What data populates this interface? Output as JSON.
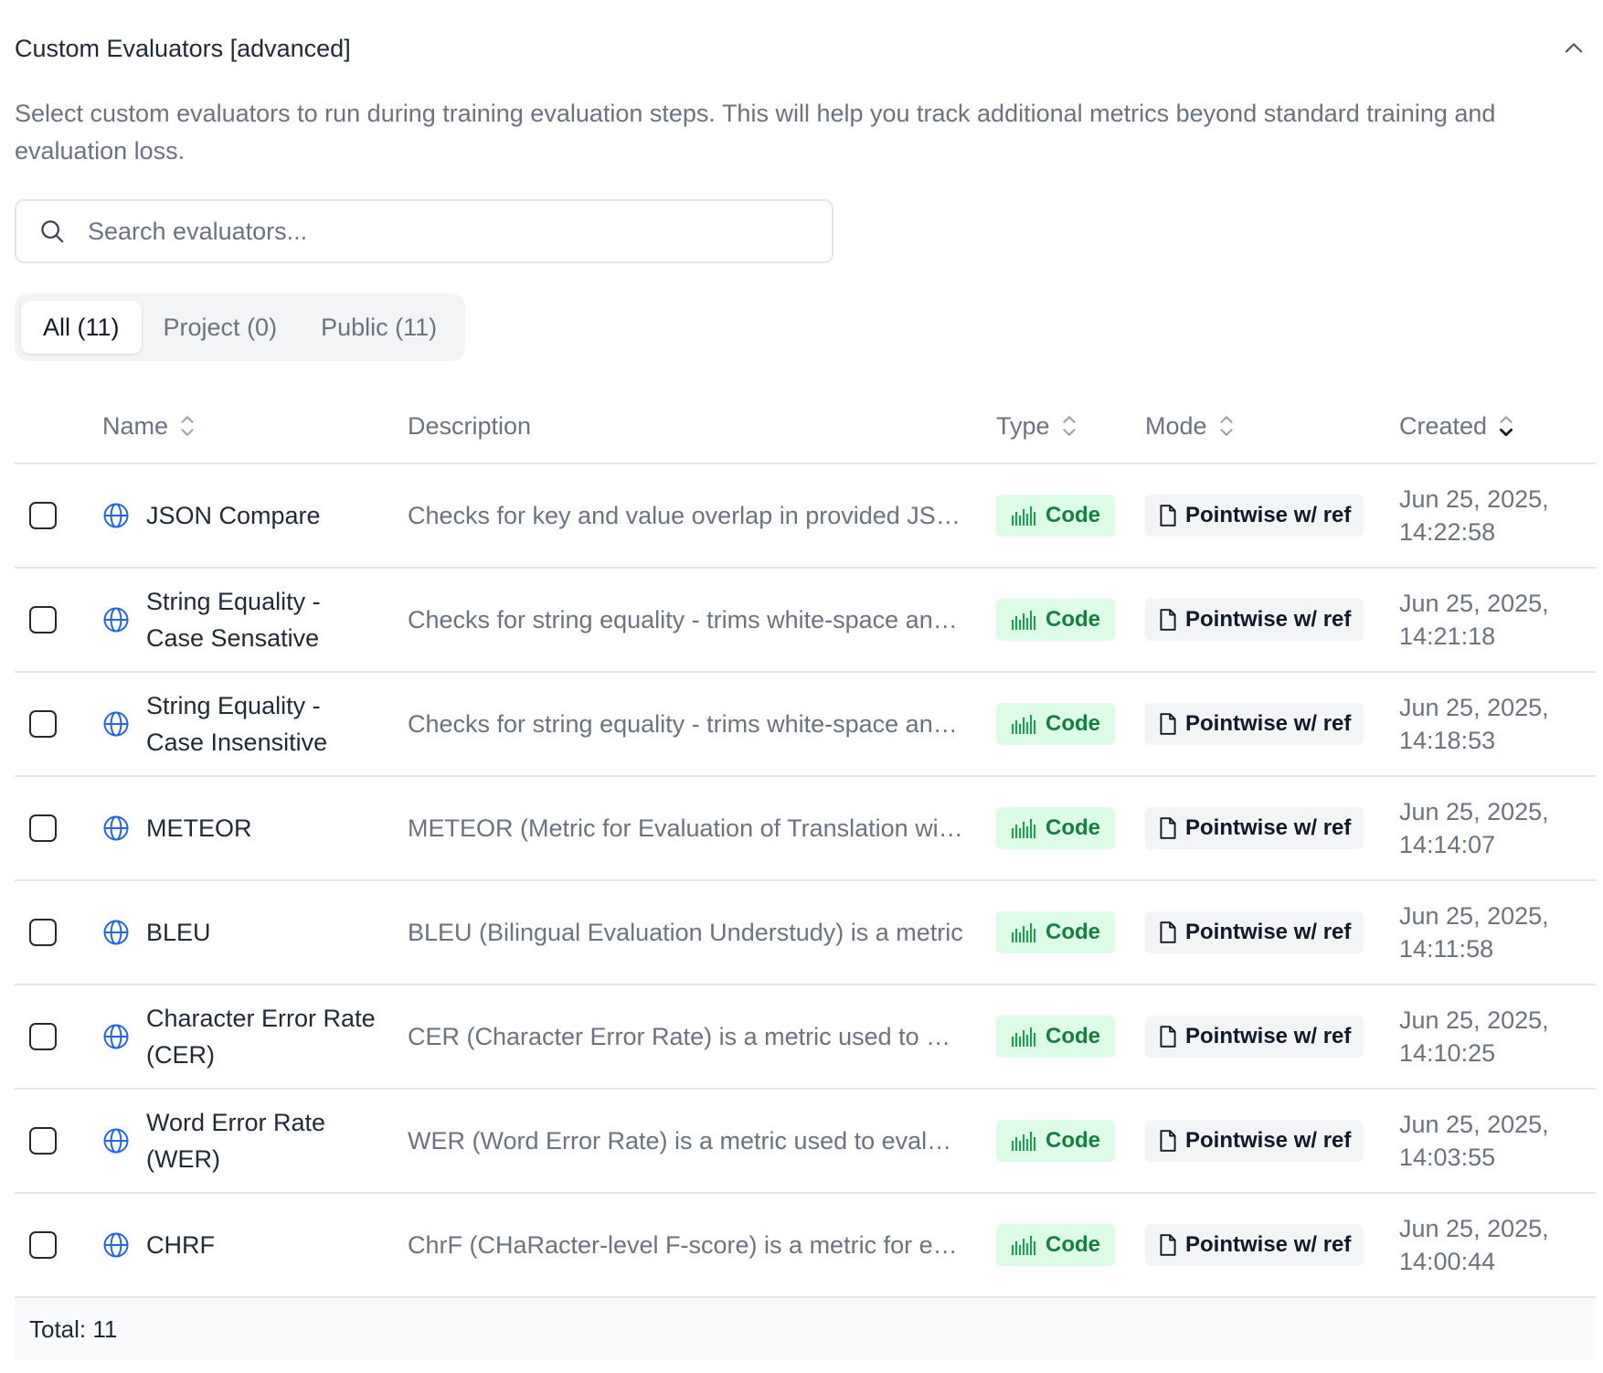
{
  "section": {
    "title": "Custom Evaluators [advanced]",
    "description": "Select custom evaluators to run during training evaluation steps. This will help you track additional metrics beyond standard training and evaluation loss."
  },
  "search": {
    "placeholder": "Search evaluators...",
    "value": ""
  },
  "tabs": [
    {
      "label": "All (11)",
      "active": true
    },
    {
      "label": "Project (0)",
      "active": false
    },
    {
      "label": "Public (11)",
      "active": false
    }
  ],
  "columns": {
    "name": "Name",
    "description": "Description",
    "type": "Type",
    "mode": "Mode",
    "created": "Created"
  },
  "rows": [
    {
      "name": "JSON Compare",
      "description": "Checks for key and value overlap in provided JSON objects",
      "type": "Code",
      "mode": "Pointwise w/ ref",
      "created_date": "Jun 25, 2025,",
      "created_time": "14:22:58"
    },
    {
      "name": "String Equality - Case Sensative",
      "description": "Checks for string equality - trims white-space and compares case sensitively",
      "type": "Code",
      "mode": "Pointwise w/ ref",
      "created_date": "Jun 25, 2025,",
      "created_time": "14:21:18"
    },
    {
      "name": "String Equality - Case Insensitive",
      "description": "Checks for string equality - trims white-space and compares case insensitively",
      "type": "Code",
      "mode": "Pointwise w/ ref",
      "created_date": "Jun 25, 2025,",
      "created_time": "14:18:53"
    },
    {
      "name": "METEOR",
      "description": "METEOR (Metric for Evaluation of Translation with Explicit ORdering)",
      "type": "Code",
      "mode": "Pointwise w/ ref",
      "created_date": "Jun 25, 2025,",
      "created_time": "14:14:07"
    },
    {
      "name": "BLEU",
      "description": "BLEU (Bilingual Evaluation Understudy) is a metric",
      "type": "Code",
      "mode": "Pointwise w/ ref",
      "created_date": "Jun 25, 2025,",
      "created_time": "14:11:58"
    },
    {
      "name": "Character Error Rate (CER)",
      "description": "CER (Character Error Rate) is a metric used to evaluate",
      "type": "Code",
      "mode": "Pointwise w/ ref",
      "created_date": "Jun 25, 2025,",
      "created_time": "14:10:25"
    },
    {
      "name": "Word Error Rate (WER)",
      "description": "WER (Word Error Rate) is a metric used to evaluate",
      "type": "Code",
      "mode": "Pointwise w/ ref",
      "created_date": "Jun 25, 2025,",
      "created_time": "14:03:55"
    },
    {
      "name": "CHRF",
      "description": "ChrF (CHaRacter-level F-score) is a metric for evaluation",
      "type": "Code",
      "mode": "Pointwise w/ ref",
      "created_date": "Jun 25, 2025,",
      "created_time": "14:00:44"
    }
  ],
  "footer": {
    "total": "Total: 11"
  },
  "colors": {
    "accent_blue": "#2563eb",
    "code_green": "#15803d",
    "code_bg": "#dcfce7",
    "mode_bg": "#f3f4f6"
  },
  "icons": {
    "collapse": "chevron-up-icon",
    "search": "search-icon",
    "row": "globe-icon",
    "type": "code-bars-icon",
    "mode": "file-icon",
    "sort": "sort-icon"
  }
}
